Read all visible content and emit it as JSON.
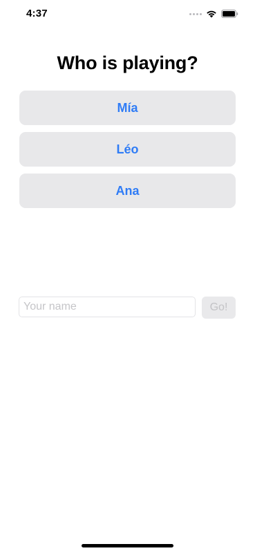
{
  "status_bar": {
    "time": "4:37"
  },
  "title": "Who is playing?",
  "players": [
    {
      "label": "Mía"
    },
    {
      "label": "Léo"
    },
    {
      "label": "Ana"
    }
  ],
  "name_entry": {
    "value": "",
    "placeholder": "Your name",
    "go_label": "Go!"
  },
  "colors": {
    "accent": "#2f7cf6",
    "button_bg": "#e8e8ea",
    "disabled_text": "#c3c3c6"
  },
  "icons": [
    "signal-dots-icon",
    "wifi-icon",
    "battery-icon"
  ]
}
